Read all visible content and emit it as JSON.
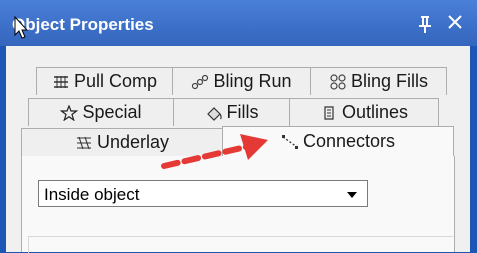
{
  "window": {
    "title": "Object Properties",
    "pin_icon": "pin-icon",
    "close_icon": "close-icon"
  },
  "tabs": [
    {
      "label": "Pull Comp",
      "icon": "pull-comp-icon"
    },
    {
      "label": "Bling Run",
      "icon": "bling-run-icon"
    },
    {
      "label": "Bling Fills",
      "icon": "bling-fills-icon"
    },
    {
      "label": "Special",
      "icon": "star-icon"
    },
    {
      "label": "Fills",
      "icon": "fills-icon"
    },
    {
      "label": "Outlines",
      "icon": "outlines-icon"
    },
    {
      "label": "Underlay",
      "icon": "underlay-icon"
    },
    {
      "label": "Connectors",
      "icon": "connectors-icon"
    }
  ],
  "active_tab": "Connectors",
  "connectors": {
    "dropdown_value": "Inside object"
  },
  "annotation": {
    "arrow_color": "#e53935"
  }
}
